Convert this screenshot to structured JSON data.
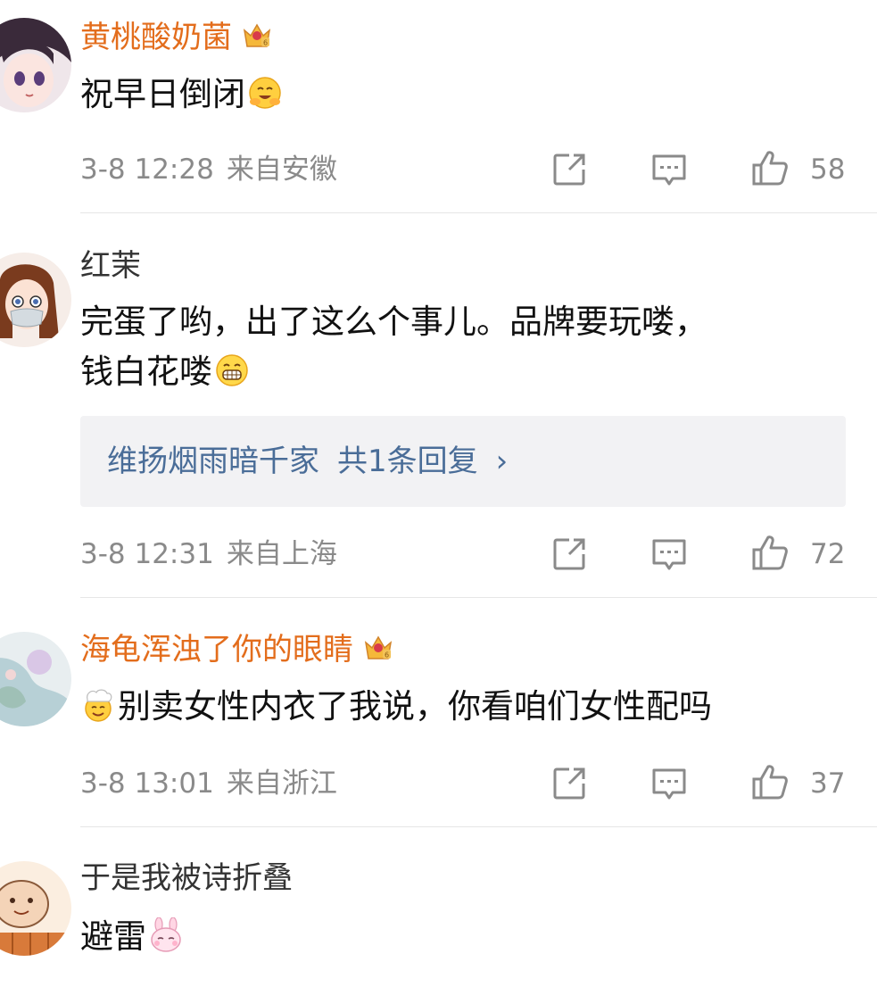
{
  "comments": [
    {
      "username": "黄桃酸奶菌",
      "vip": true,
      "text": "祝早日倒闭",
      "time": "3-8 12:28",
      "location": "来自安徽",
      "likes": "58",
      "emoji": "hug-emoji"
    },
    {
      "username": "红茉",
      "vip": false,
      "text_line1": "完蛋了哟，出了这么个事儿。品牌要玩喽，",
      "text_line2": "钱白花喽",
      "reply_user": "维扬烟雨暗千家",
      "reply_count": "共1条回复",
      "reply_chevron": "›",
      "time": "3-8 12:31",
      "location": "来自上海",
      "likes": "72",
      "emoji": "grin-emoji"
    },
    {
      "username": "海龟浑浊了你的眼睛",
      "vip": true,
      "text": "别卖女性内衣了我说，你看咱们女性配吗",
      "time": "3-8 13:01",
      "location": "来自浙江",
      "likes": "37",
      "emoji": "chef-emoji"
    },
    {
      "username": "于是我被诗折叠",
      "vip": false,
      "text": "避雷",
      "emoji": "bunny-emoji"
    }
  ],
  "colors": {
    "vip_name": "#e36d1c",
    "meta": "#8a8a8a",
    "reply_link": "#4a6d98"
  }
}
